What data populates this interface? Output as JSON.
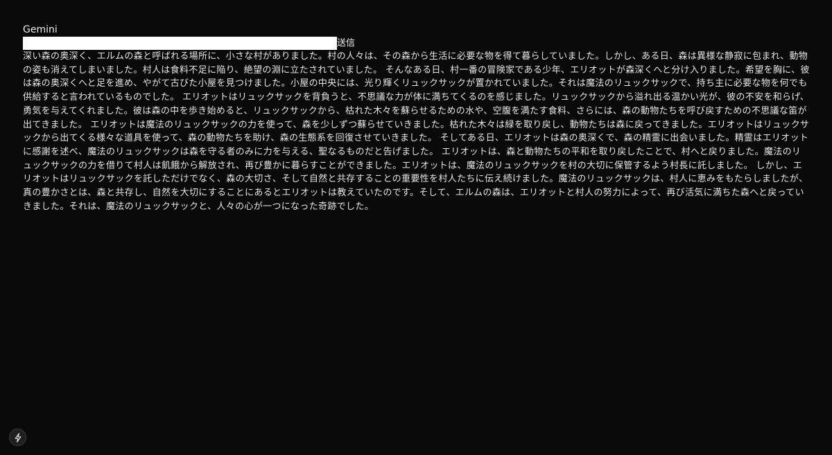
{
  "app": {
    "title": "Gemini"
  },
  "prompt": {
    "value": "",
    "placeholder": ""
  },
  "send_button": {
    "label": "送信"
  },
  "response": {
    "text": "深い森の奥深く、エルムの森と呼ばれる場所に、小さな村がありました。村の人々は、その森から生活に必要な物を得て暮らしていました。しかし、ある日、森は異様な静寂に包まれ、動物の姿も消えてしまいました。村人は食料不足に陥り、絶望の淵に立たされていました。 そんなある日、村一番の冒険家である少年、エリオットが森深くへと分け入りました。希望を胸に、彼は森の奥深くへと足を進め、やがて古びた小屋を見つけました。小屋の中央には、光り輝くリュックサックが置かれていました。それは魔法のリュックサックで、持ち主に必要な物を何でも供給すると言われているものでした。 エリオットはリュックサックを背負うと、不思議な力が体に満ちてくるのを感じました。リュックサックから溢れ出る温かい光が、彼の不安を和らげ、勇気を与えてくれました。彼は森の中を歩き始めると、リュックサックから、枯れた木々を蘇らせるための水や、空腹を満たす食料、さらには、森の動物たちを呼び戻すための不思議な笛が出てきました。 エリオットは魔法のリュックサックの力を使って、森を少しずつ蘇らせていきました。枯れた木々は緑を取り戻し、動物たちは森に戻ってきました。エリオットはリュックサックから出てくる様々な道具を使って、森の動物たちを助け、森の生態系を回復させていきました。 そしてある日、エリオットは森の奥深くで、森の精霊に出会いました。精霊はエリオットに感謝を述べ、魔法のリュックサックは森を守る者のみに力を与える、聖なるものだと告げました。 エリオットは、森と動物たちの平和を取り戻したことで、村へと戻りました。魔法のリュックサックの力を借りて村人は飢餓から解放され、再び豊かに暮らすことができました。エリオットは、魔法のリュックサックを村の大切に保管するよう村長に託しました。 しかし、エリオットはリュックサックを託しただけでなく、森の大切さ、そして自然と共存することの重要性を村人たちに伝え続けました。魔法のリュックサックは、村人に恵みをもたらしましたが、真の豊かさとは、森と共存し、自然を大切にすることにあるとエリオットは教えていたのです。そして、エルムの森は、エリオットと村人の努力によって、再び活気に満ちた森へと戻っていきました。それは、魔法のリュックサックと、人々の心が一つになった奇跡でした。"
  },
  "floating_button": {
    "icon": "lightning-bolt-icon"
  },
  "colors": {
    "background": "#0a0a0a",
    "text": "#e6e6e6",
    "input_background": "#ffffff"
  }
}
